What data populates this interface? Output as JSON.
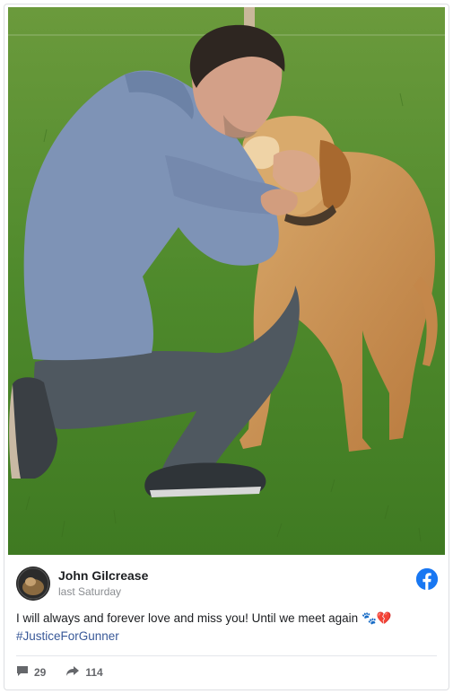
{
  "post": {
    "author": "John Gilcrease",
    "time": "last Saturday",
    "text": "I will always and forever love and miss you! Until we meet again",
    "emoji": "🐾💔",
    "hashtag": "#JusticeForGunner"
  },
  "stats": {
    "comments": "29",
    "shares": "114"
  },
  "colors": {
    "facebook_blue": "#1877f2",
    "hashtag": "#385898",
    "grass": "#4f8a2c"
  },
  "icons": [
    "facebook-icon",
    "comment-icon",
    "share-icon"
  ]
}
